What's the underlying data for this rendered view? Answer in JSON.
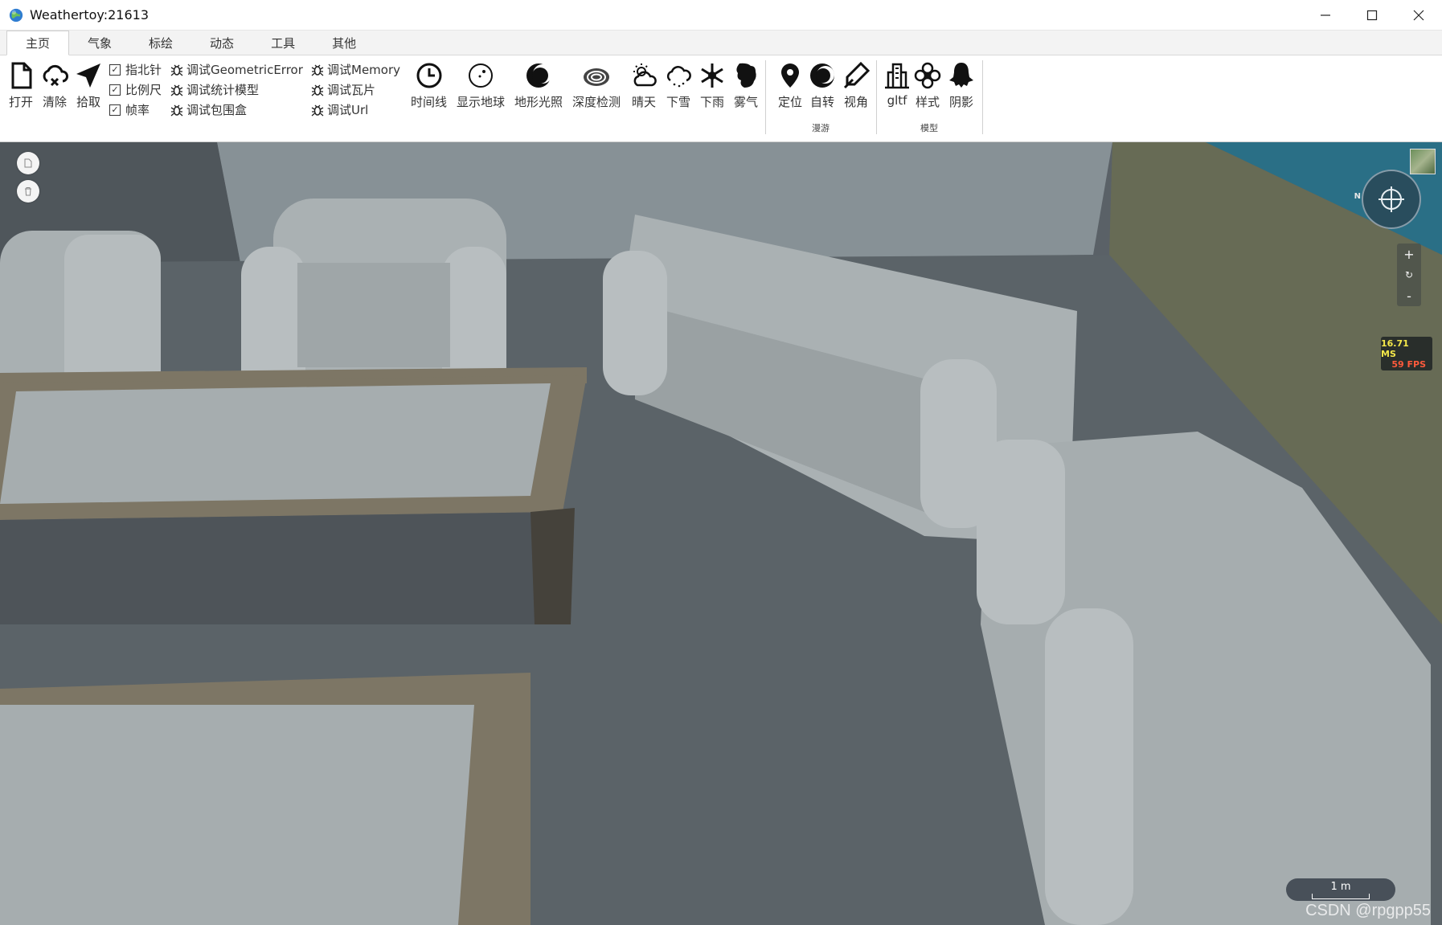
{
  "window": {
    "title": "Weathertoy:21613",
    "controls": [
      "minimize",
      "maximize",
      "close"
    ]
  },
  "tabs": [
    {
      "label": "主页",
      "active": true
    },
    {
      "label": "气象",
      "active": false
    },
    {
      "label": "标绘",
      "active": false
    },
    {
      "label": "动态",
      "active": false
    },
    {
      "label": "工具",
      "active": false
    },
    {
      "label": "其他",
      "active": false
    }
  ],
  "ribbon": {
    "file_buttons": [
      {
        "label": "打开",
        "icon": "file-icon"
      },
      {
        "label": "清除",
        "icon": "cloud-clear-icon"
      },
      {
        "label": "拾取",
        "icon": "pick-arrow-icon"
      }
    ],
    "checkboxes": [
      {
        "label": "指北针",
        "checked": true
      },
      {
        "label": "比例尺",
        "checked": true
      },
      {
        "label": "帧率",
        "checked": true
      }
    ],
    "debug_col1": [
      {
        "label": "调试GeometricError",
        "icon": "bug-icon"
      },
      {
        "label": "调试统计模型",
        "icon": "bug-icon"
      },
      {
        "label": "调试包围盒",
        "icon": "bug-icon"
      }
    ],
    "debug_col2": [
      {
        "label": "调试Memory",
        "icon": "bug-icon"
      },
      {
        "label": "调试瓦片",
        "icon": "bug-icon"
      },
      {
        "label": "调试Url",
        "icon": "bug-icon"
      }
    ],
    "scene_buttons": [
      {
        "label": "时间线",
        "icon": "clock-icon"
      },
      {
        "label": "显示地球",
        "icon": "globe-icon"
      },
      {
        "label": "地形光照",
        "icon": "moon-icon"
      },
      {
        "label": "深度检测",
        "icon": "depth-cloud-icon"
      },
      {
        "label": "晴天",
        "icon": "sunny-icon"
      },
      {
        "label": "下雪",
        "icon": "snow-cloud-icon"
      },
      {
        "label": "下雨",
        "icon": "snowflake-icon"
      },
      {
        "label": "雾气",
        "icon": "fog-icon"
      }
    ],
    "roam_buttons": [
      {
        "label": "定位",
        "icon": "location-pin-icon"
      },
      {
        "label": "自转",
        "icon": "rotate-icon"
      },
      {
        "label": "视角",
        "icon": "view-angle-icon"
      }
    ],
    "roam_group_label": "漫游",
    "model_buttons": [
      {
        "label": "gltf",
        "icon": "building-icon"
      },
      {
        "label": "样式",
        "icon": "flower-icon"
      },
      {
        "label": "阴影",
        "icon": "ghost-icon"
      }
    ],
    "model_group_label": "模型"
  },
  "viewport": {
    "fps": {
      "ms": "16.71 MS",
      "fps": "59 FPS"
    },
    "scale_label": "1 m",
    "compass_north": "N",
    "zoom_in": "+",
    "zoom_reset": "↻",
    "zoom_out": "-",
    "watermark": "CSDN @rpgpp55"
  }
}
